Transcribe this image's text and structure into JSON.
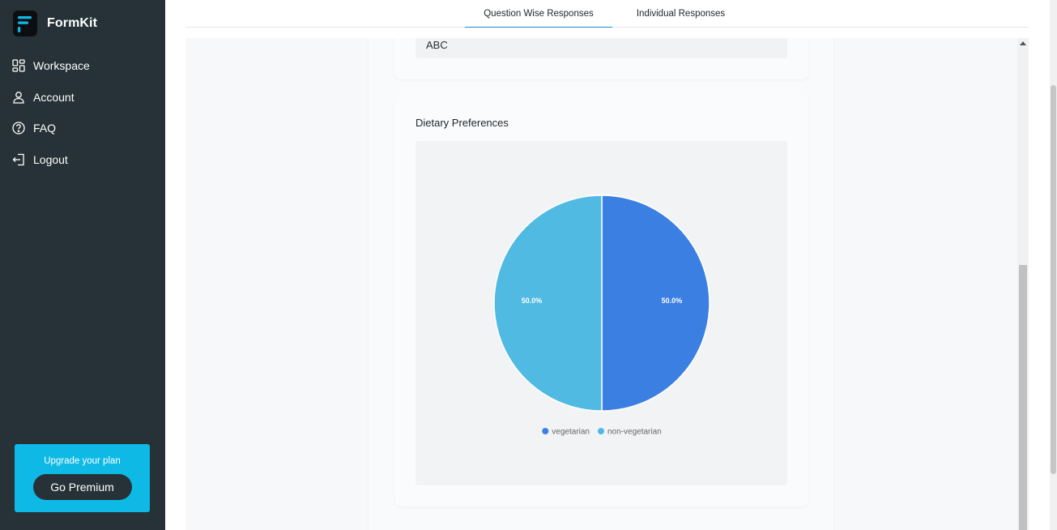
{
  "app": {
    "name": "FormKit",
    "brand_color": "#0fb9e6",
    "sidebar_color": "#263238"
  },
  "sidebar": {
    "items": [
      {
        "label": "Workspace",
        "icon": "grid-icon"
      },
      {
        "label": "Account",
        "icon": "user-icon"
      },
      {
        "label": "FAQ",
        "icon": "help-circle-icon"
      },
      {
        "label": "Logout",
        "icon": "logout-icon"
      }
    ],
    "upgrade": {
      "text": "Upgrade your plan",
      "button_label": "Go Premium"
    }
  },
  "tabs": [
    {
      "label": "Question Wise Responses",
      "active": true
    },
    {
      "label": "Individual Responses",
      "active": false
    }
  ],
  "responses": {
    "previous_answer": "ABC",
    "question_title": "Dietary Preferences"
  },
  "chart_data": {
    "type": "pie",
    "series": [
      {
        "name": "vegetarian",
        "value": 50.0,
        "label": "50.0%",
        "color": "#3b7fe3"
      },
      {
        "name": "non-vegetarian",
        "value": 50.0,
        "label": "50.0%",
        "color": "#50bae2"
      }
    ],
    "legend_position": "bottom"
  }
}
